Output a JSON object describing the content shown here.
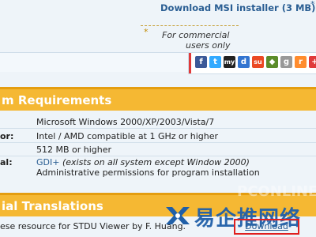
{
  "top": {
    "msi_link": "Download MSI installer (3 MB)",
    "msi_star": "*",
    "note_star": "*",
    "note_line1": "For commercial",
    "note_line2": "users only"
  },
  "share": {
    "icons": [
      "facebook-icon",
      "twitter-icon",
      "myspace-icon",
      "delicious-icon",
      "stumbleupon-icon",
      "digg-icon",
      "google-icon",
      "reddit-icon",
      "more-icon"
    ],
    "glyphs": [
      "f",
      "t",
      "my",
      "d",
      "su",
      "◆",
      "g",
      "r",
      "+"
    ]
  },
  "requirements": {
    "header": "m Requirements",
    "rows": [
      {
        "label": "",
        "value": "Microsoft Windows 2000/XP/2003/Vista/7"
      },
      {
        "label": "or:",
        "value": "Intel / AMD compatible at 1 GHz or higher"
      },
      {
        "label": "",
        "value": "512 MB or higher"
      },
      {
        "label": "al:",
        "value_link": "GDI+",
        "value_italic": " (exists on all system except Window 2000)",
        "value2": "Administrative permissions for program installation"
      }
    ]
  },
  "translations": {
    "header": "ial Translations",
    "row_text": "ese resource for STDU Viewer by F. Huang.",
    "download_label": "Download"
  },
  "watermark": {
    "text": "易企推网络",
    "faint": "PCONLINE"
  },
  "colors": {
    "header_bg": "#f5b833",
    "link": "#2a5e93",
    "download_border": "#e01f1f"
  }
}
